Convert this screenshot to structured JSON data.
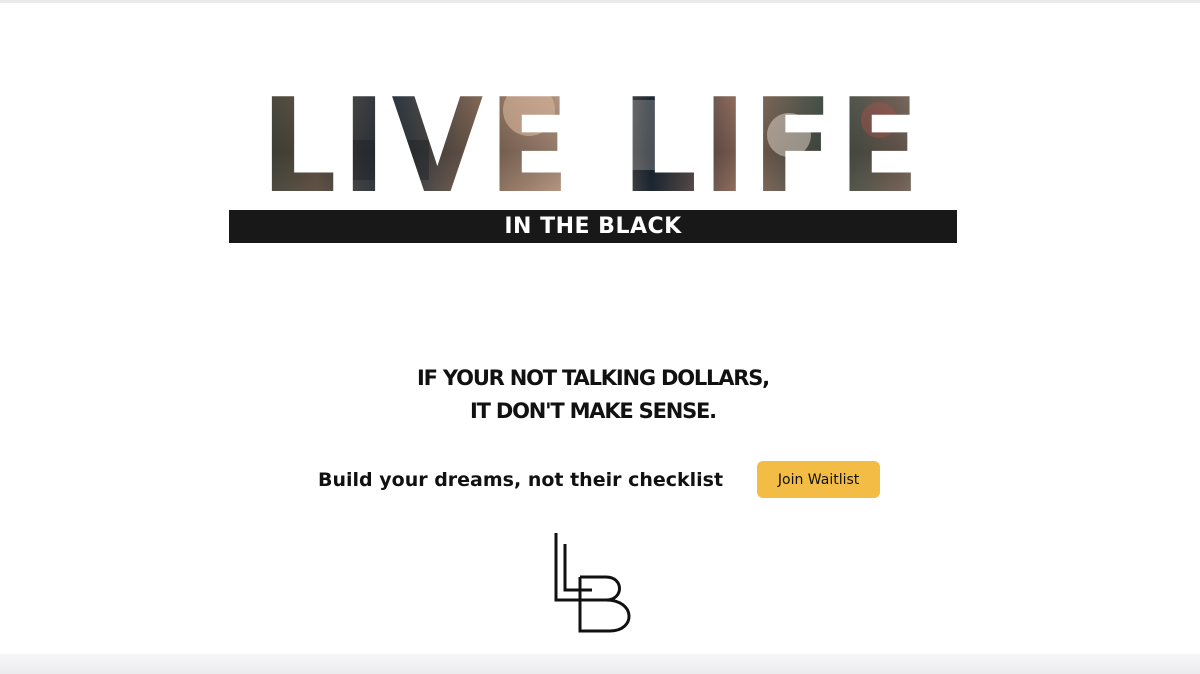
{
  "hero": {
    "headline": "LIVE LIFE",
    "band_text": "IN THE BLACK"
  },
  "tagline": {
    "line1": "IF YOUR NOT TALKING DOLLARS,",
    "line2": "IT DON'T MAKE SENSE."
  },
  "cta": {
    "text": "Build your dreams, not their checklist",
    "button_label": "Join Waitlist"
  },
  "logo": {
    "name": "lb-monogram-icon"
  },
  "colors": {
    "background": "#ffffff",
    "band": "#181818",
    "button": "#f2bc45",
    "text": "#111111"
  }
}
